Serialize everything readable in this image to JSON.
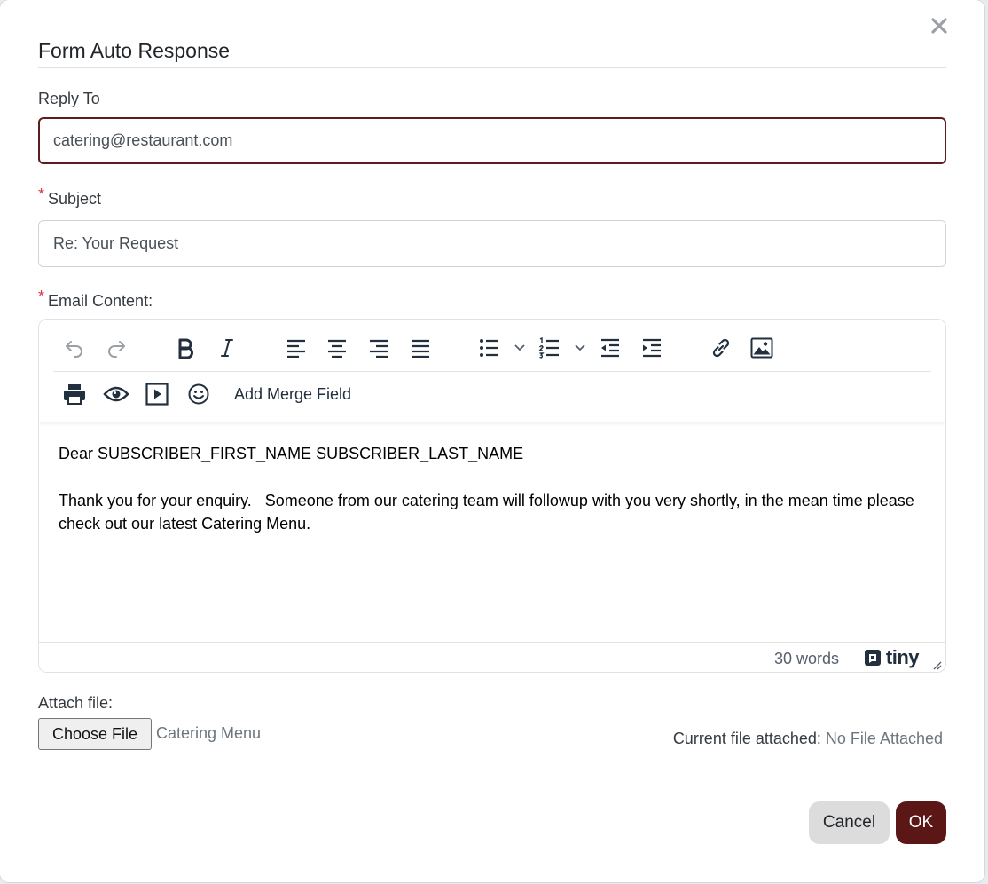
{
  "modal": {
    "title": "Form Auto Response",
    "close_icon": "close-icon"
  },
  "reply_to": {
    "label": "Reply To",
    "value": "catering@restaurant.com"
  },
  "subject": {
    "required_mark": "*",
    "label": "Subject",
    "value": "Re: Your Request"
  },
  "email_content": {
    "required_mark": "*",
    "label": "Email Content:",
    "toolbar": {
      "row1": [
        "undo-icon",
        "redo-icon",
        "bold-icon",
        "italic-icon",
        "align-left-icon",
        "align-center-icon",
        "align-right-icon",
        "align-justify-icon",
        "bullet-list-icon",
        "numbered-list-icon",
        "outdent-icon",
        "indent-icon",
        "link-icon",
        "image-icon"
      ],
      "row2": [
        "print-icon",
        "preview-icon",
        "media-icon",
        "emoji-icon"
      ],
      "merge_field_label": "Add Merge Field"
    },
    "body": {
      "line1": "Dear SUBSCRIBER_FIRST_NAME SUBSCRIBER_LAST_NAME",
      "line2": "Thank you for your enquiry.   Someone from our catering team will followup with you very shortly, in the mean time please check out our latest Catering Menu."
    },
    "status": {
      "word_count": "30 words",
      "brand": "tiny"
    }
  },
  "attach": {
    "label": "Attach file:",
    "choose_button": "Choose File",
    "file_name": "Catering Menu",
    "current_label": "Current file attached:",
    "current_value": "No File Attached"
  },
  "actions": {
    "cancel": "Cancel",
    "ok": "OK"
  },
  "colors": {
    "accent": "#5b1716",
    "required": "#dc3545"
  }
}
